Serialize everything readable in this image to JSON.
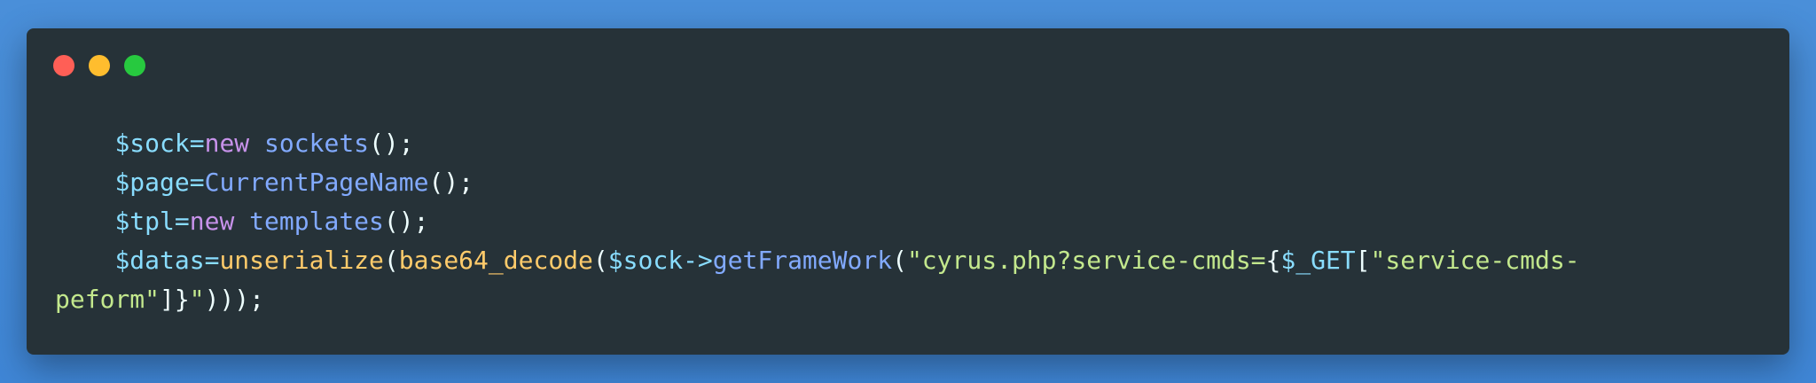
{
  "window": {
    "controls": [
      "close",
      "minimize",
      "maximize"
    ],
    "colors": {
      "background": "#263238",
      "close": "#ff5f56",
      "minimize": "#ffbd2e",
      "maximize": "#27c93f"
    }
  },
  "code": {
    "language": "php",
    "lines": [
      {
        "indent": "    ",
        "tokens": [
          {
            "t": "$sock",
            "k": "var"
          },
          {
            "t": "=",
            "k": "op"
          },
          {
            "t": "new",
            "k": "kw"
          },
          {
            "t": " ",
            "k": "punc"
          },
          {
            "t": "sockets",
            "k": "cls"
          },
          {
            "t": "();",
            "k": "punc"
          }
        ]
      },
      {
        "indent": "    ",
        "tokens": [
          {
            "t": "$page",
            "k": "var"
          },
          {
            "t": "=",
            "k": "op"
          },
          {
            "t": "CurrentPageName",
            "k": "fnc"
          },
          {
            "t": "();",
            "k": "punc"
          }
        ]
      },
      {
        "indent": "    ",
        "tokens": [
          {
            "t": "$tpl",
            "k": "var"
          },
          {
            "t": "=",
            "k": "op"
          },
          {
            "t": "new",
            "k": "kw"
          },
          {
            "t": " ",
            "k": "punc"
          },
          {
            "t": "templates",
            "k": "cls"
          },
          {
            "t": "();",
            "k": "punc"
          }
        ]
      },
      {
        "indent": "    ",
        "tokens": [
          {
            "t": "$datas",
            "k": "var"
          },
          {
            "t": "=",
            "k": "op"
          },
          {
            "t": "unserialize",
            "k": "fn"
          },
          {
            "t": "(",
            "k": "punc"
          },
          {
            "t": "base64_decode",
            "k": "fn"
          },
          {
            "t": "(",
            "k": "punc"
          },
          {
            "t": "$sock",
            "k": "var"
          },
          {
            "t": "->",
            "k": "op"
          },
          {
            "t": "getFrameWork",
            "k": "fnc"
          },
          {
            "t": "(",
            "k": "punc"
          },
          {
            "t": "\"cyrus.php?service-cmds=",
            "k": "str"
          },
          {
            "t": "{",
            "k": "punc"
          },
          {
            "t": "$_GET",
            "k": "var"
          },
          {
            "t": "[",
            "k": "punc"
          },
          {
            "t": "\"service-cmds-",
            "k": "str"
          }
        ]
      },
      {
        "indent": "",
        "tokens": [
          {
            "t": "peform\"",
            "k": "str"
          },
          {
            "t": "]}",
            "k": "punc"
          },
          {
            "t": "\"",
            "k": "str"
          },
          {
            "t": ")));",
            "k": "punc"
          }
        ]
      }
    ]
  }
}
